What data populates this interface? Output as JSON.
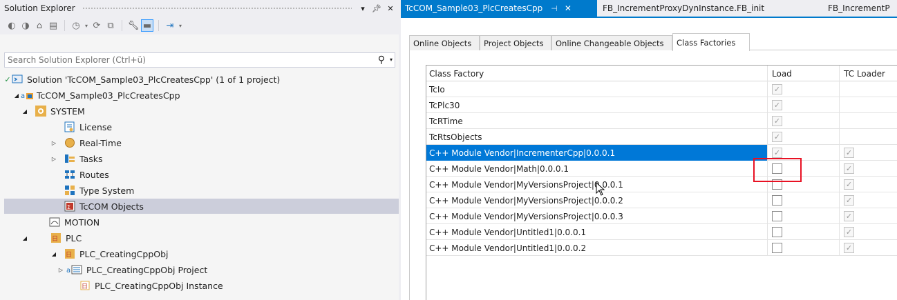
{
  "solution_explorer": {
    "title": "Solution Explorer",
    "search_placeholder": "Search Solution Explorer (Ctrl+ü)",
    "tree": [
      {
        "label": "Solution 'TcCOM_Sample03_PlcCreatesCpp' (1 of 1 project)",
        "icon": "solution-icon"
      },
      {
        "label": "TcCOM_Sample03_PlcCreatesCpp",
        "icon": "twincat-project-icon"
      },
      {
        "label": "SYSTEM",
        "icon": "system-icon"
      },
      {
        "label": "License",
        "icon": "license-icon"
      },
      {
        "label": "Real-Time",
        "icon": "realtime-icon"
      },
      {
        "label": "Tasks",
        "icon": "tasks-icon"
      },
      {
        "label": "Routes",
        "icon": "routes-icon"
      },
      {
        "label": "Type System",
        "icon": "type-system-icon"
      },
      {
        "label": "TcCOM Objects",
        "icon": "tccom-objects-icon"
      },
      {
        "label": "MOTION",
        "icon": "motion-icon"
      },
      {
        "label": "PLC",
        "icon": "plc-icon"
      },
      {
        "label": "PLC_CreatingCppObj",
        "icon": "plc-project-icon"
      },
      {
        "label": "PLC_CreatingCppObj Project",
        "icon": "plc-subproject-icon"
      },
      {
        "label": "PLC_CreatingCppObj Instance",
        "icon": "plc-instance-icon"
      }
    ]
  },
  "document": {
    "tabs": [
      {
        "label": "TcCOM_Sample03_PlcCreatesCpp"
      },
      {
        "label": "FB_IncrementProxyDynInstance.FB_init"
      },
      {
        "label": "FB_IncrementP"
      }
    ],
    "subtabs": [
      {
        "label": "Online Objects"
      },
      {
        "label": "Project Objects"
      },
      {
        "label": "Online Changeable Objects"
      },
      {
        "label": "Class Factories"
      }
    ],
    "columns": [
      "Class Factory",
      "Load",
      "TC Loader"
    ],
    "rows": [
      {
        "name": "TcIo",
        "load": "dis",
        "tc": "none"
      },
      {
        "name": "TcPlc30",
        "load": "dis",
        "tc": "none"
      },
      {
        "name": "TcRTime",
        "load": "dis",
        "tc": "none"
      },
      {
        "name": "TcRtsObjects",
        "load": "dis",
        "tc": "none"
      },
      {
        "name": "C++ Module Vendor|IncrementerCpp|0.0.0.1",
        "load": "dis",
        "tc": "dis"
      },
      {
        "name": "C++ Module Vendor|Math|0.0.0.1",
        "load": "empty",
        "tc": "dis"
      },
      {
        "name": "C++ Module Vendor|MyVersionsProject|0.0.0.1",
        "load": "empty",
        "tc": "dis"
      },
      {
        "name": "C++ Module Vendor|MyVersionsProject|0.0.0.2",
        "load": "empty",
        "tc": "dis"
      },
      {
        "name": "C++ Module Vendor|MyVersionsProject|0.0.0.3",
        "load": "empty",
        "tc": "dis"
      },
      {
        "name": "C++ Module Vendor|Untitled1|0.0.0.1",
        "load": "empty",
        "tc": "dis"
      },
      {
        "name": "C++ Module Vendor|Untitled1|0.0.0.2",
        "load": "empty",
        "tc": "dis"
      }
    ]
  }
}
